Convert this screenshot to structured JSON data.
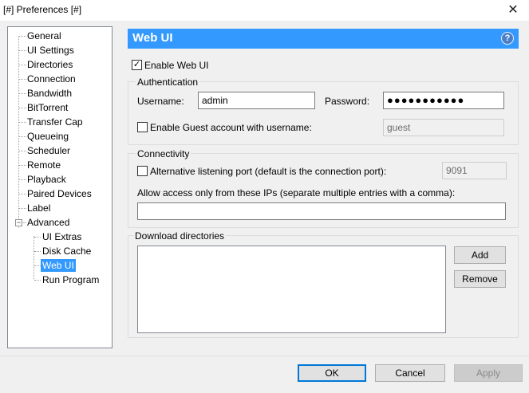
{
  "window": {
    "title": "[#] Preferences [#]",
    "close_glyph": "✕"
  },
  "sidebar": {
    "items": [
      {
        "label": "General"
      },
      {
        "label": "UI Settings"
      },
      {
        "label": "Directories"
      },
      {
        "label": "Connection"
      },
      {
        "label": "Bandwidth"
      },
      {
        "label": "BitTorrent"
      },
      {
        "label": "Transfer Cap"
      },
      {
        "label": "Queueing"
      },
      {
        "label": "Scheduler"
      },
      {
        "label": "Remote"
      },
      {
        "label": "Playback"
      },
      {
        "label": "Paired Devices"
      },
      {
        "label": "Label"
      },
      {
        "label": "Advanced"
      },
      {
        "label": "UI Extras"
      },
      {
        "label": "Disk Cache"
      },
      {
        "label": "Web UI"
      },
      {
        "label": "Run Program"
      }
    ],
    "selected": "Web UI",
    "expander_glyph": "−"
  },
  "panel": {
    "title": "Web UI",
    "help_glyph": "?",
    "enable_webui": {
      "label": "Enable Web UI",
      "checked": true,
      "check_glyph": "✓"
    },
    "authentication": {
      "title": "Authentication",
      "username_label": "Username:",
      "username_value": "admin",
      "password_label": "Password:",
      "password_mask": "●●●●●●●●●●●",
      "guest_label": "Enable Guest account with username:",
      "guest_checked": false,
      "guest_value": "guest"
    },
    "connectivity": {
      "title": "Connectivity",
      "alt_port_label": "Alternative listening port (default is the connection port):",
      "alt_port_checked": false,
      "alt_port_value": "9091",
      "allow_ips_label": "Allow access only from these IPs (separate multiple entries with a comma):",
      "allow_ips_value": ""
    },
    "download_dirs": {
      "title": "Download directories",
      "add_label": "Add",
      "remove_label": "Remove"
    }
  },
  "footer": {
    "ok_label": "OK",
    "cancel_label": "Cancel",
    "apply_label": "Apply"
  },
  "colors": {
    "accent": "#3399ff",
    "dialog_bg": "#f0f0f0"
  }
}
